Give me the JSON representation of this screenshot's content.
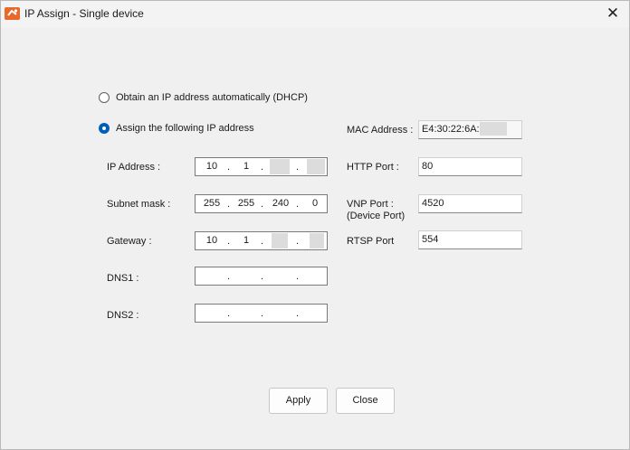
{
  "window": {
    "title": "IP Assign - Single device",
    "close_glyph": "✕"
  },
  "options": {
    "dhcp_label": "Obtain an IP address automatically (DHCP)",
    "static_label": "Assign the following IP address",
    "selected": "static"
  },
  "fields": {
    "ip_label": "IP Address :",
    "ip": [
      "10",
      "1",
      "",
      ""
    ],
    "subnet_label": "Subnet mask :",
    "subnet": [
      "255",
      "255",
      "240",
      "0"
    ],
    "gateway_label": "Gateway :",
    "gateway": [
      "10",
      "1",
      "",
      ""
    ],
    "dns1_label": "DNS1 :",
    "dns1": [
      "",
      "",
      "",
      ""
    ],
    "dns2_label": "DNS2 :",
    "dns2": [
      "",
      "",
      "",
      ""
    ]
  },
  "ports": {
    "mac_label": "MAC Address :",
    "mac_value": "E4:30:22:6A:",
    "http_label": "HTTP Port :",
    "http_value": "80",
    "vnp_label": "VNP Port :",
    "vnp_sub": "(Device Port)",
    "vnp_value": "4520",
    "rtsp_label": "RTSP Port",
    "rtsp_value": "554"
  },
  "buttons": {
    "apply": "Apply",
    "close": "Close"
  },
  "colors": {
    "accent": "#005fb8",
    "icon": "#e8672a"
  }
}
